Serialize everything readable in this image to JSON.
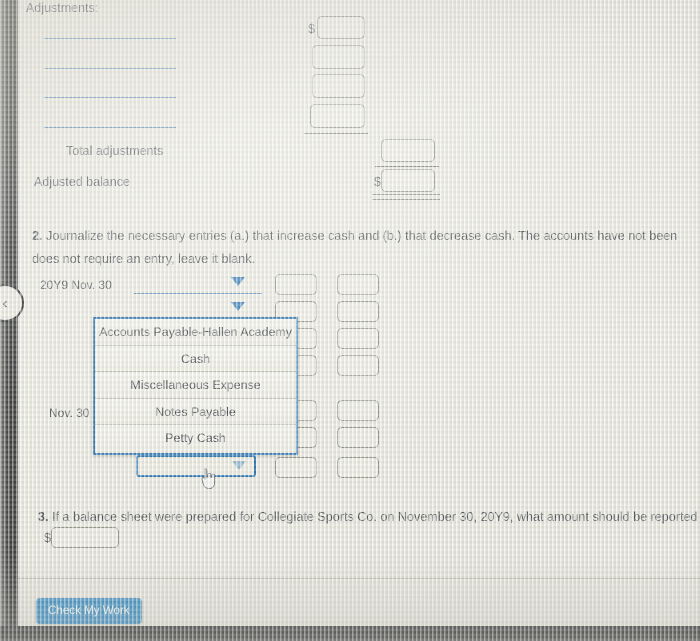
{
  "section1": {
    "heading": "Adjustments:",
    "total_label": "Total adjustments",
    "adjusted_label": "Adjusted balance",
    "currency_symbol": "$",
    "adjustment_rows": 4,
    "amount_boxes": [
      "",
      "",
      "",
      ""
    ],
    "total_box": "",
    "adjusted_box": ""
  },
  "question2": {
    "number": "2.",
    "text": "Journalize the necessary entries (a.) that increase cash and (b.) that decrease cash. The accounts have not been",
    "text_line2": "does not require an entry, leave it blank.",
    "row1_date": "20Y9 Nov. 30",
    "row2_date": "Nov. 30",
    "debit_column": [
      "",
      "",
      "",
      "",
      "",
      "",
      ""
    ],
    "credit_column": [
      "",
      "",
      "",
      "",
      "",
      "",
      ""
    ],
    "dropdown_open": true,
    "dropdown_options": [
      "Accounts Payable-Hallen Academy",
      "Cash",
      "Miscellaneous Expense",
      "Notes Payable",
      "Petty Cash"
    ],
    "selected_value": ""
  },
  "question3": {
    "number": "3.",
    "text": "If a balance sheet were prepared for Collegiate Sports Co. on November 30, 20Y9, what amount should be reported",
    "currency_symbol": "$",
    "answer_box": ""
  },
  "footer": {
    "check_label": "Check My Work"
  },
  "nav": {
    "prev_icon": "chevron-left-icon",
    "prev_glyph": "‹"
  },
  "colors": {
    "accent_blue": "#1a7ec0",
    "rule_blue": "#4a7fb5",
    "dropdown_border": "#1567ad",
    "box_border": "#8a8f82",
    "page_bg": "#eceae3"
  }
}
